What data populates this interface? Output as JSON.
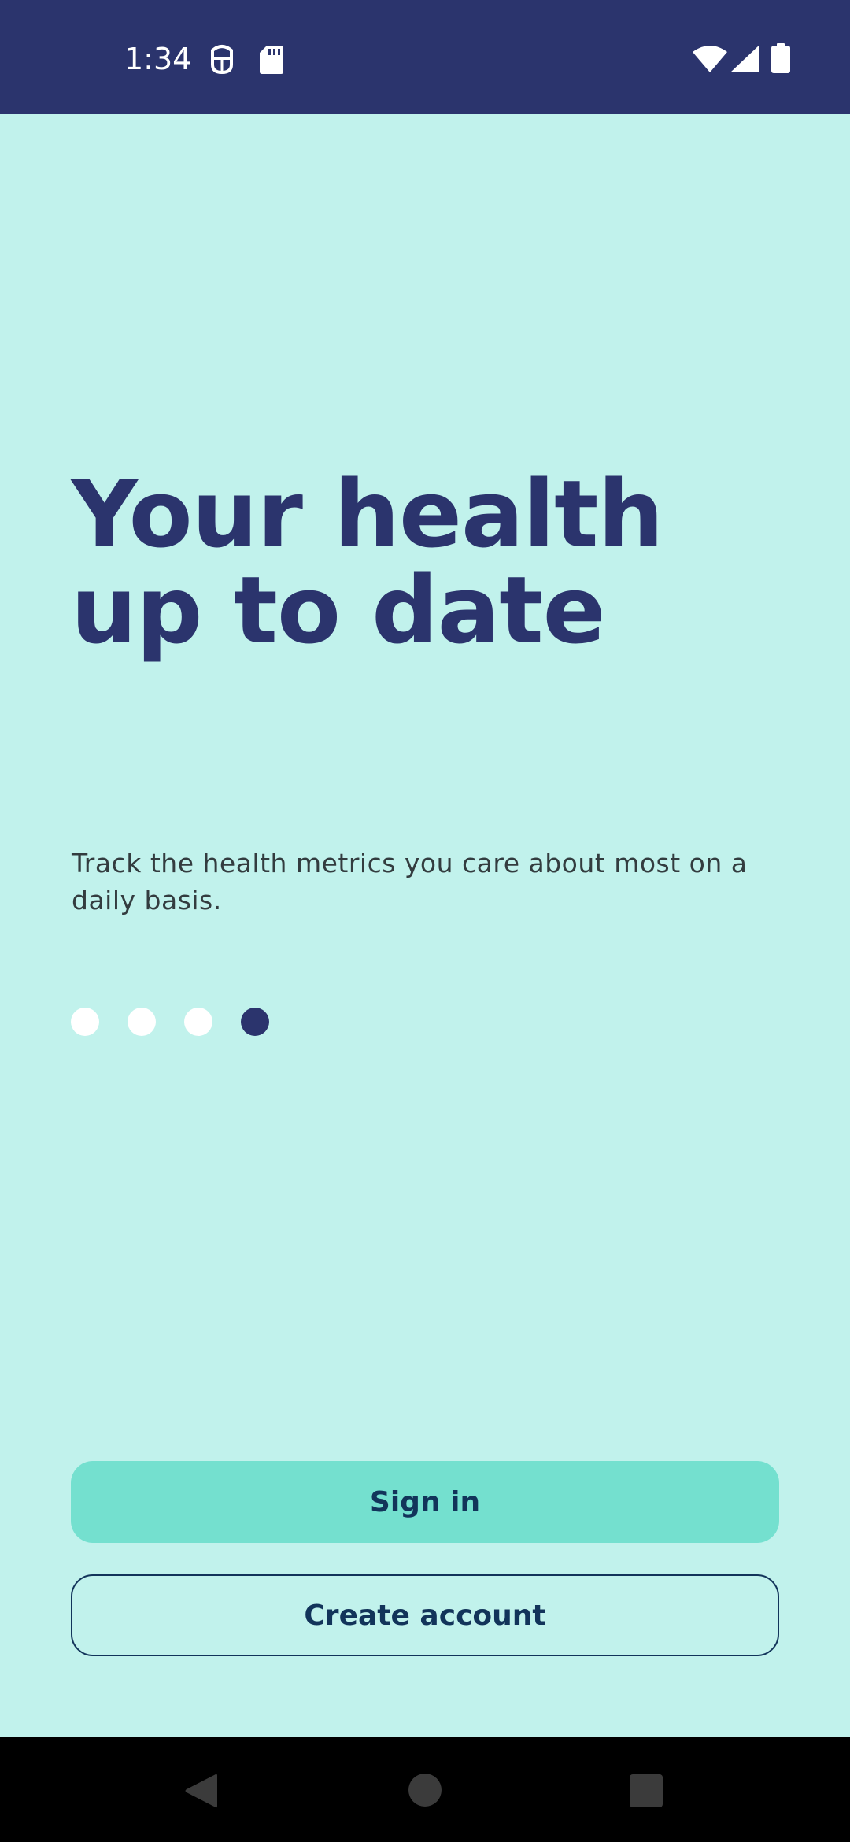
{
  "status_bar": {
    "time": "1:34",
    "background_color": "#2b346d",
    "icons": [
      "debug-icon",
      "sd-card-icon",
      "wifi-icon",
      "cellular-signal-icon",
      "battery-icon"
    ]
  },
  "onboarding": {
    "headline_line1": "Your health",
    "headline_line2": "up to date",
    "subtitle": "Track the health metrics you care about most on a daily basis.",
    "page_indicator": {
      "total": 4,
      "current": 4
    }
  },
  "actions": {
    "sign_in_label": "Sign in",
    "create_account_label": "Create account"
  },
  "navigation_bar": {
    "buttons": [
      "back-icon",
      "home-icon",
      "recents-icon"
    ]
  },
  "colors": {
    "background": "#c1f2ec",
    "primary_dark": "#2b346d",
    "accent": "#74e0cf",
    "button_text": "#12345a"
  }
}
